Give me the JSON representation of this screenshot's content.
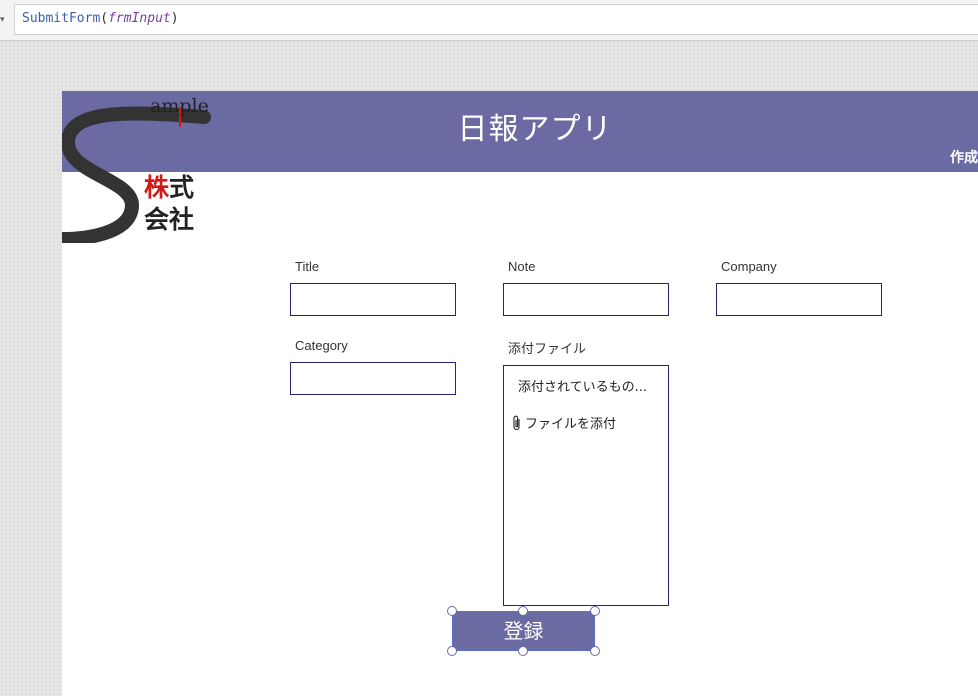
{
  "formula_bar": {
    "function": "SubmitForm",
    "open_paren": "(",
    "argument": "frmInput",
    "close_paren": ")"
  },
  "header": {
    "title": "日報アプリ",
    "creator": "作成"
  },
  "logo": {
    "sample_text": "ample",
    "kanji_line1_red": "株",
    "kanji_line1_rest": "式",
    "kanji_line2": "会社"
  },
  "form": {
    "title_label": "Title",
    "note_label": "Note",
    "company_label": "Company",
    "category_label": "Category",
    "attachment_label": "添付ファイル",
    "attachment_empty": "添付されているもの...",
    "attach_file_link": "ファイルを添付"
  },
  "submit_button": {
    "label": "登録"
  },
  "colors": {
    "header_bg": "#6b6aa3",
    "border": "#2b2172",
    "logo_red": "#d11b1b"
  }
}
